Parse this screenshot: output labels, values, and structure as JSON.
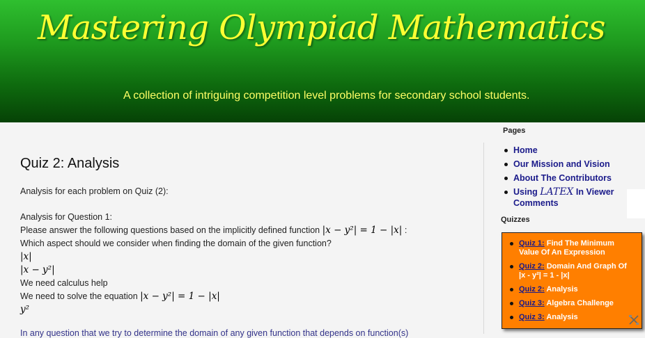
{
  "header": {
    "title": "Mastering Olympiad Mathematics",
    "tagline": "A collection of intriguing competition level problems for secondary school students."
  },
  "post": {
    "title": "Quiz 2: Analysis",
    "intro": "Analysis for each problem on Quiz (2):",
    "q_heading": "Analysis for Question 1:",
    "q_text": "Please answer the following questions based on the implicitly defined function",
    "q_colon": ":",
    "equation": "|x − y²| = 1 − |x|",
    "question": "Which aspect should we consider when finding the domain of the given function?",
    "option1": "|x|",
    "option2": "|x − y²|",
    "option3": "We need calculus help",
    "option4_text": "We need to solve the equation",
    "option4_eq": "|x − y²| = 1 − |x|",
    "option5": "y²",
    "truncated": "In any question that we try to determine the domain of any given function that depends on function(s)"
  },
  "sidebar": {
    "pages_heading": "Pages",
    "pages": [
      {
        "label": "Home"
      },
      {
        "label": "Our Mission and Vision"
      },
      {
        "label": "About The Contributors"
      },
      {
        "label_pre": "Using",
        "latex": "LATEX",
        "label_post": "In Viewer Comments"
      }
    ],
    "quizzes_heading": "Quizzes",
    "quizzes": [
      {
        "link": "Quiz 1:",
        "text": "Find The Minimum Value Of An Expression"
      },
      {
        "link": "Quiz 2:",
        "text": "Domain And Graph Of |x - y²| = 1 - |x|"
      },
      {
        "link": "Quiz 2:",
        "text": "Analysis"
      },
      {
        "link": "Quiz 3:",
        "text": "Algebra Challenge"
      },
      {
        "link": "Quiz 3:",
        "text": "Analysis"
      }
    ]
  },
  "colors": {
    "header_green": "#1e9a1e",
    "title_yellow": "#ffff33",
    "quiz_box_orange": "#ff7f00",
    "link_blue": "#1a1a8a"
  },
  "icons": {
    "resize": "resize-tools-icon"
  }
}
